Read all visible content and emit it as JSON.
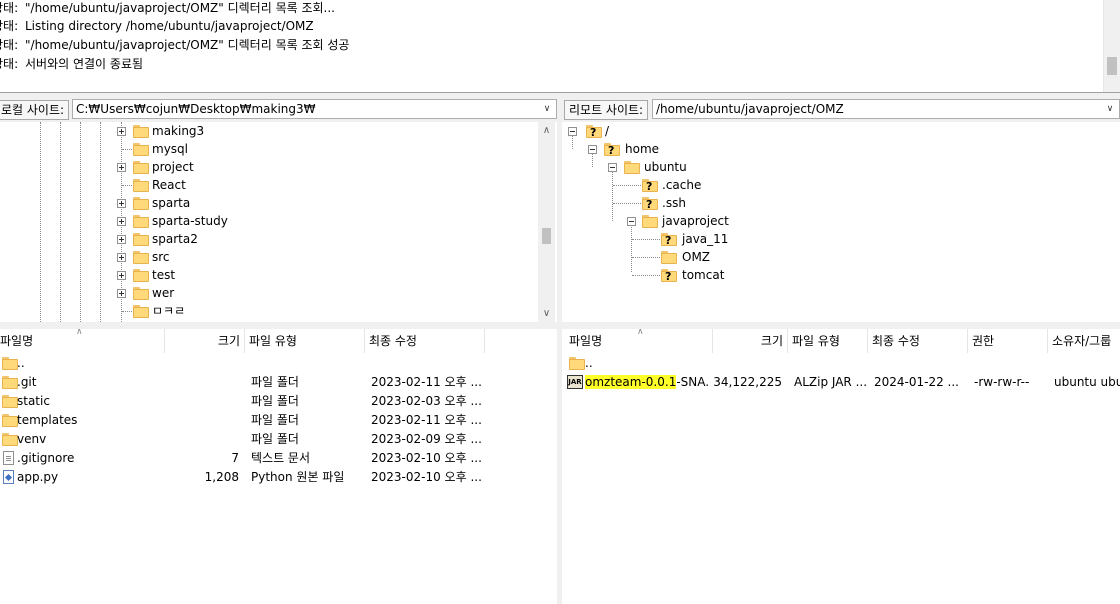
{
  "log": [
    {
      "label": "상태:",
      "text": "\"/home/ubuntu/javaproject/OMZ\" 디렉터리 목록 조회..."
    },
    {
      "label": "상태:",
      "text": "Listing directory /home/ubuntu/javaproject/OMZ"
    },
    {
      "label": "상태:",
      "text": "\"/home/ubuntu/javaproject/OMZ\" 디렉터리 목록 조회 성공"
    },
    {
      "label": "상태:",
      "text": "서버와의 연결이 종료됨"
    }
  ],
  "local": {
    "site_label": "로컬 사이트:",
    "path": "C:₩Users₩cojun₩Desktop₩making3₩",
    "tree": [
      "making3",
      "mysql",
      "project",
      "React",
      "sparta",
      "sparta-study",
      "sparta2",
      "src",
      "test",
      "wer",
      "ㅁㅋㄹ"
    ],
    "columns": [
      "파일명",
      "크기",
      "파일 유형",
      "최종 수정"
    ],
    "files": [
      {
        "name": "..",
        "size": "",
        "type": "",
        "modified": "",
        "icon": "folder-icon"
      },
      {
        "name": ".git",
        "size": "",
        "type": "파일 폴더",
        "modified": "2023-02-11 오후 ...",
        "icon": "folder-icon"
      },
      {
        "name": "static",
        "size": "",
        "type": "파일 폴더",
        "modified": "2023-02-03 오후 ...",
        "icon": "folder-icon"
      },
      {
        "name": "templates",
        "size": "",
        "type": "파일 폴더",
        "modified": "2023-02-11 오후 ...",
        "icon": "folder-icon"
      },
      {
        "name": "venv",
        "size": "",
        "type": "파일 폴더",
        "modified": "2023-02-09 오후 ...",
        "icon": "folder-icon"
      },
      {
        "name": ".gitignore",
        "size": "7",
        "type": "텍스트 문서",
        "modified": "2023-02-10 오후 ...",
        "icon": "text-file-icon"
      },
      {
        "name": "app.py",
        "size": "1,208",
        "type": "Python 원본 파일",
        "modified": "2023-02-10 오후 ...",
        "icon": "python-file-icon"
      }
    ]
  },
  "remote": {
    "site_label": "리모트 사이트:",
    "path": "/home/ubuntu/javaproject/OMZ",
    "tree": {
      "root": "/",
      "home": "home",
      "ubuntu": "ubuntu",
      "cache": ".cache",
      "ssh": ".ssh",
      "javaproject": "javaproject",
      "java11": "java_11",
      "omz": "OMZ",
      "tomcat": "tomcat"
    },
    "columns": [
      "파일명",
      "크기",
      "파일 유형",
      "최종 수정",
      "권한",
      "소유자/그룹"
    ],
    "files": [
      {
        "name": "..",
        "name_rest": "",
        "size": "",
        "type": "",
        "modified": "",
        "perms": "",
        "owner": "",
        "icon": "folder-icon"
      },
      {
        "name": "omzteam-0.0.1",
        "name_rest": "-SNA...",
        "size": "34,122,225",
        "type": "ALZip JAR ...",
        "modified": "2024-01-22 ...",
        "perms": "-rw-rw-r--",
        "owner": "ubuntu ubu...",
        "icon": "jar-file-icon"
      }
    ]
  },
  "colors": {
    "highlight": "#ffff2a",
    "folder": "#ffd97a"
  }
}
